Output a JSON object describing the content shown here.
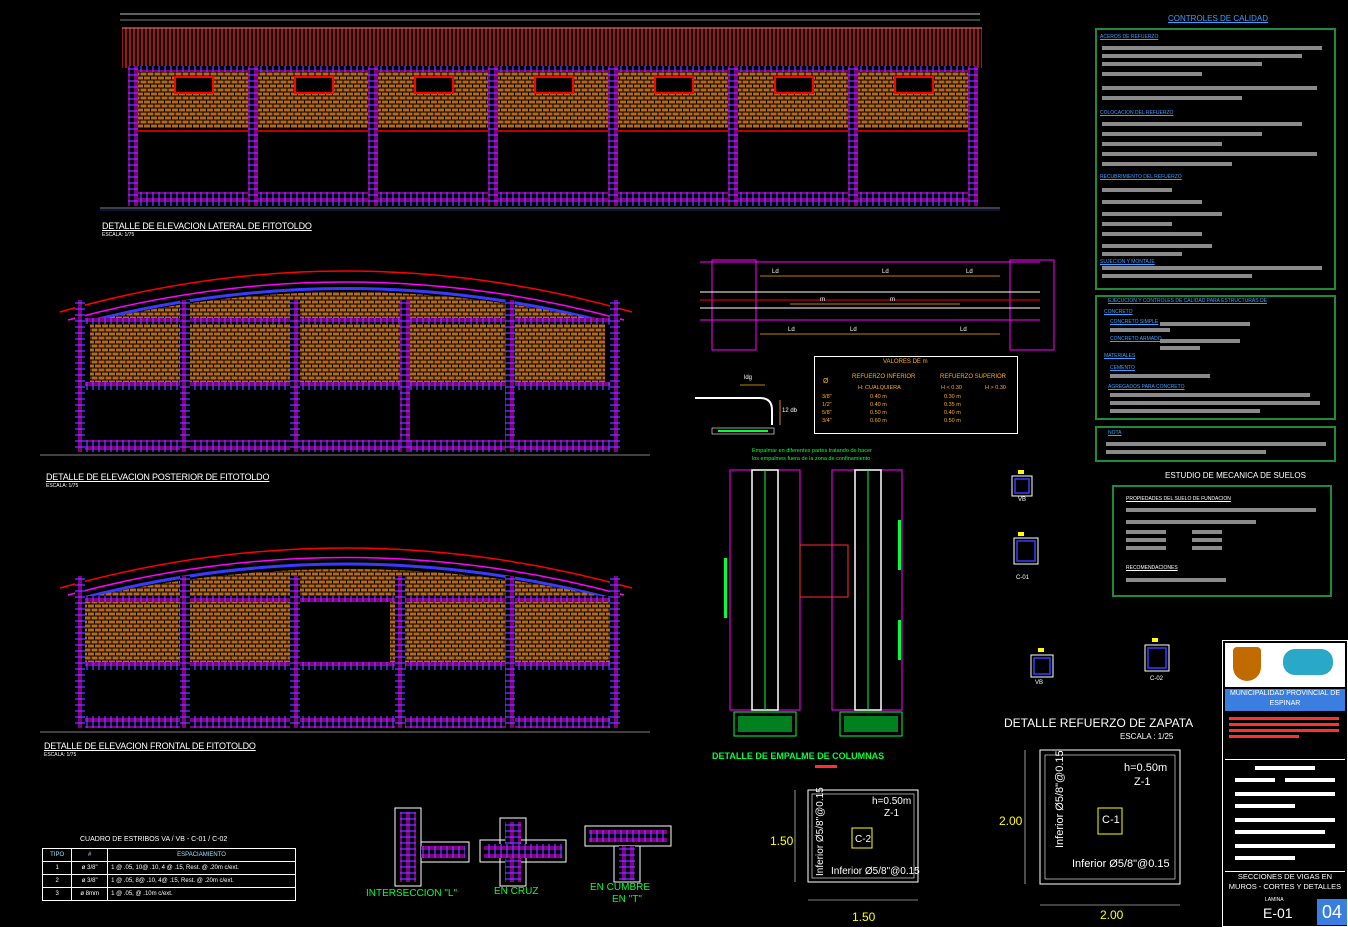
{
  "elevations": {
    "lateral": {
      "title": "DETALLE DE ELEVACION LATERAL DE FITOTOLDO",
      "scale": "ESCALA: 1/75"
    },
    "posterior": {
      "title": "DETALLE DE ELEVACION POSTERIOR DE FITOTOLDO",
      "scale": "ESCALA: 1/75"
    },
    "frontal": {
      "title": "DETALLE DE ELEVACION FRONTAL DE FITOTOLDO",
      "scale": "ESCALA: 1/75"
    }
  },
  "quality": {
    "heading": "CONTROLES DE CALIDAD",
    "sections": [
      "ACEROS DE REFUERZO",
      "COLOCACION DEL REFUERZO",
      "RECUBRIMIENTO DEL REFUERZO",
      "SUJECION Y MONTAJE"
    ],
    "box2_title": "EJECUCION Y CONTROLES DE CALIDAD PARA ESTRUCTURAS DE",
    "box2_items": [
      "CONCRETO",
      "CONCRETO SIMPLE",
      "CONCRETO ARMADO",
      "MATERIALES",
      "CEMENTO",
      "AGREGADOS PARA CONCRETO"
    ],
    "box3_title": "NOTA"
  },
  "soil": {
    "heading": "ESTUDIO DE MECANICA DE SUELOS",
    "sec1": "PROPIEDADES DEL SUELO DE FUNDACION",
    "sec2": "RECOMENDACIONES"
  },
  "splice": {
    "labels": [
      "Ld",
      "Ld",
      "Ld",
      "m",
      "m",
      "Ld",
      "Ld",
      "Ld"
    ],
    "hook_ldg": "ldg",
    "hook_12db": "12 db",
    "note_line1": "Empalmar en diferentes partes tratando de hacer",
    "note_line2": "los empalmes fuera de la zona de confinamiento",
    "title": "DETALLE DE EMPALME DE COLUMNAS"
  },
  "valores_m": {
    "title": "VALORES DE m",
    "col_phi": "Ø",
    "col_inf": "REFUERZO INFERIOR",
    "col_sup": "REFUERZO SUPERIOR",
    "sub_inf": "H: CUALQUIERA",
    "sub_sup1": "H < 0.30",
    "sub_sup2": "H > 0.30",
    "rows": [
      [
        "3/8\"",
        "0.40 m",
        "0.30 m"
      ],
      [
        "1/2\"",
        "0.40 m",
        "0.35 m"
      ],
      [
        "5/8\"",
        "0.50 m",
        "0.40 m"
      ],
      [
        "3/4\"",
        "0.60 m",
        "0.50 m"
      ]
    ]
  },
  "estribos": {
    "title": "CUADRO DE ESTRIBOS VA / VB - C-01 / C-02",
    "headers": [
      "TIPO",
      "#",
      "ESPACIAMIENTO"
    ],
    "rows": [
      [
        "1",
        "ø 3/8\"",
        "1 @ .05, 10@ .10, 4 @ .15, Rest. @ .20m c/ext."
      ],
      [
        "2",
        "ø 3/8\"",
        "1 @ .05, 8@ .10, 4@ .15, Rest. @ .20m c/ext."
      ],
      [
        "3",
        "ø 8mm",
        "1 @ .05, @ .10m c/ext."
      ]
    ]
  },
  "intersections": [
    {
      "label": "INTERSECCION \"L\""
    },
    {
      "label": "EN CRUZ"
    },
    {
      "label": "EN CUMBRE",
      "label2": "EN \"T\""
    }
  ],
  "col_sections": [
    "VB",
    "C-01",
    "VB",
    "C-02"
  ],
  "zapata": {
    "title": "DETALLE REFUERZO DE ZAPATA",
    "scale": "ESCALA : 1/25",
    "small": {
      "h": "h=0.50m",
      "id": "Z-1",
      "col": "C-2",
      "bars_h": "Inferior Ø5/8\"@0.15",
      "bars_v": "Inferior Ø5/8\"@0.15",
      "dim_x": "1.50",
      "dim_y": "1.50"
    },
    "large": {
      "h": "h=0.50m",
      "id": "Z-1",
      "col": "C-1",
      "bars_h": "Inferior Ø5/8\"@0.15",
      "bars_v": "Inferior Ø5/8\"@0.15",
      "dim_x": "2.00",
      "dim_y": "2.00"
    }
  },
  "titleblock": {
    "entity": "MUNICIPALIDAD PROVINCIAL DE ESPINAR",
    "sheet_title": "SECCIONES DE VIGAS EN MUROS - CORTES Y DETALLES",
    "sheet_code": "E-01",
    "sheet_num": "04",
    "lamina_label": "LAMINA"
  },
  "colors": {
    "green": "#00ff3c",
    "magenta": "#ff00ff",
    "blue": "#3a3aff",
    "red": "#ff0000",
    "yellow": "#ffff00",
    "orange": "#ffb000",
    "cyan": "#00e5ff",
    "brick": "#b56a1a"
  }
}
